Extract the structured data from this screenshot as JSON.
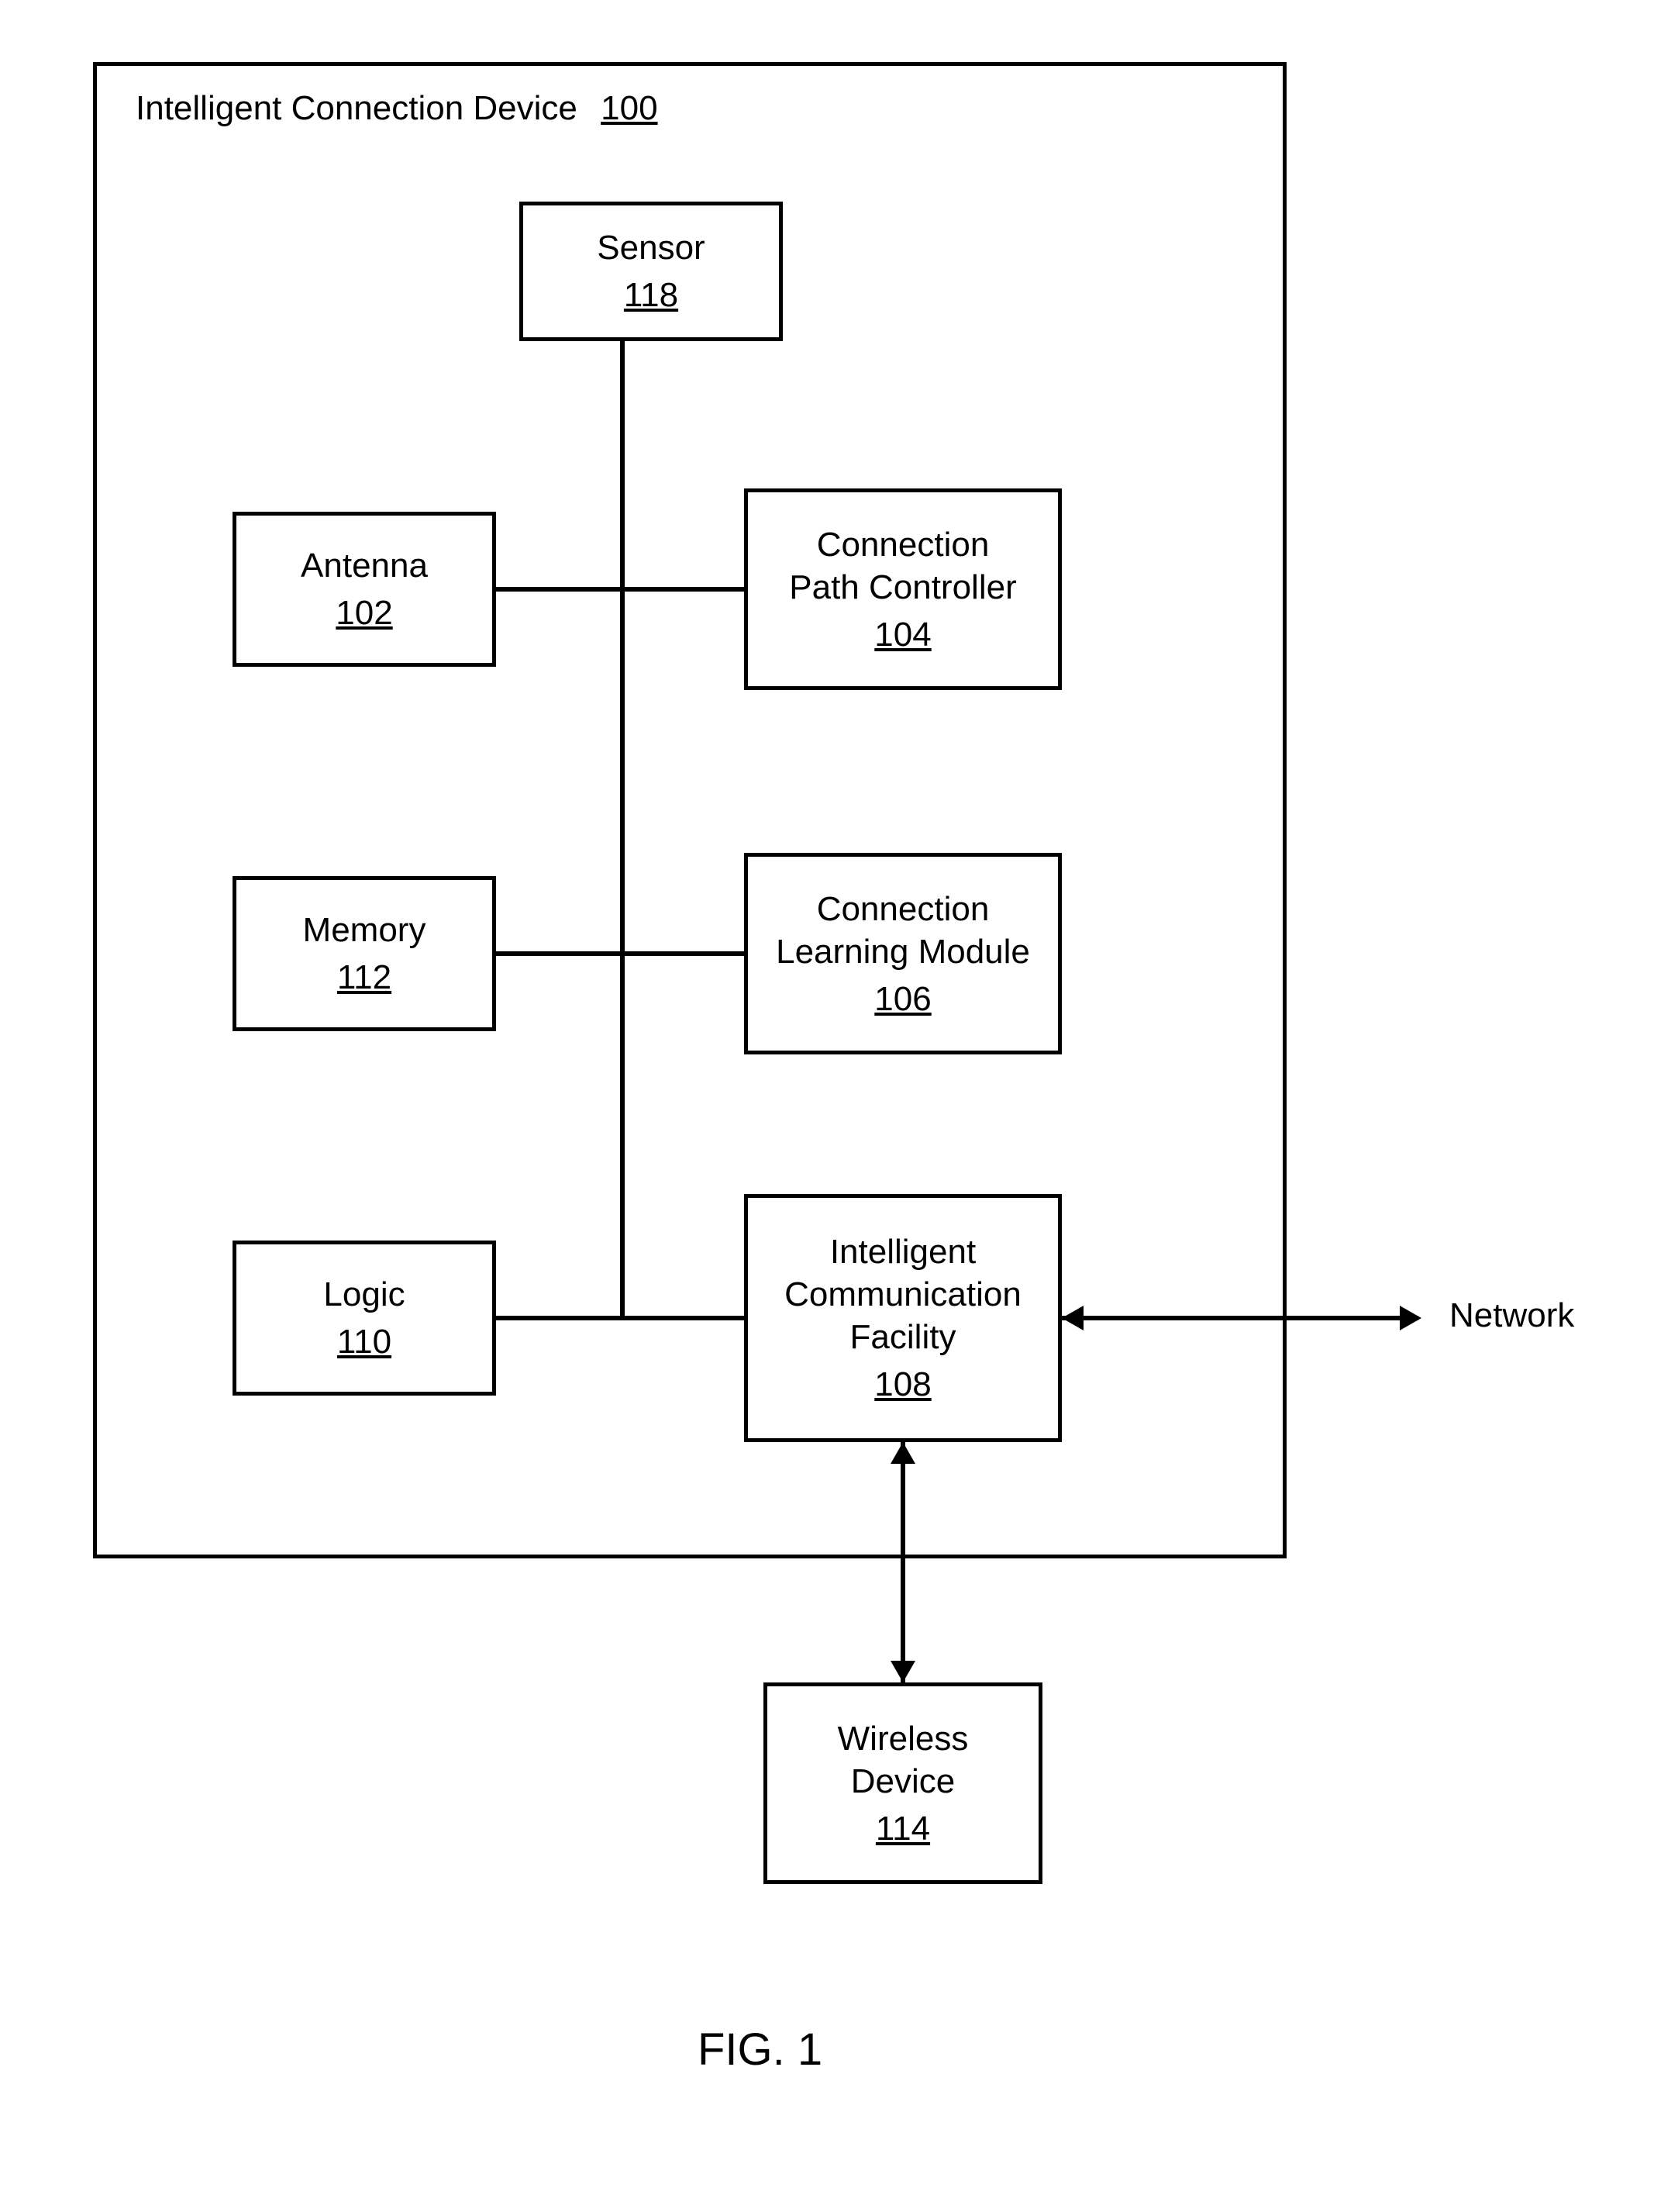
{
  "outer": {
    "title": "Intelligent Connection Device",
    "num": "100"
  },
  "sensor": {
    "label": "Sensor",
    "num": "118"
  },
  "antenna": {
    "label": "Antenna",
    "num": "102"
  },
  "cpc": {
    "label1": "Connection",
    "label2": "Path Controller",
    "num": "104"
  },
  "memory": {
    "label": "Memory",
    "num": "112"
  },
  "clm": {
    "label1": "Connection",
    "label2": "Learning Module",
    "num": "106"
  },
  "logic": {
    "label": "Logic",
    "num": "110"
  },
  "icf": {
    "label1": "Intelligent",
    "label2": "Communication",
    "label3": "Facility",
    "num": "108"
  },
  "wireless": {
    "label1": "Wireless",
    "label2": "Device",
    "num": "114"
  },
  "network_label": "Network",
  "figure_label": "FIG. 1"
}
